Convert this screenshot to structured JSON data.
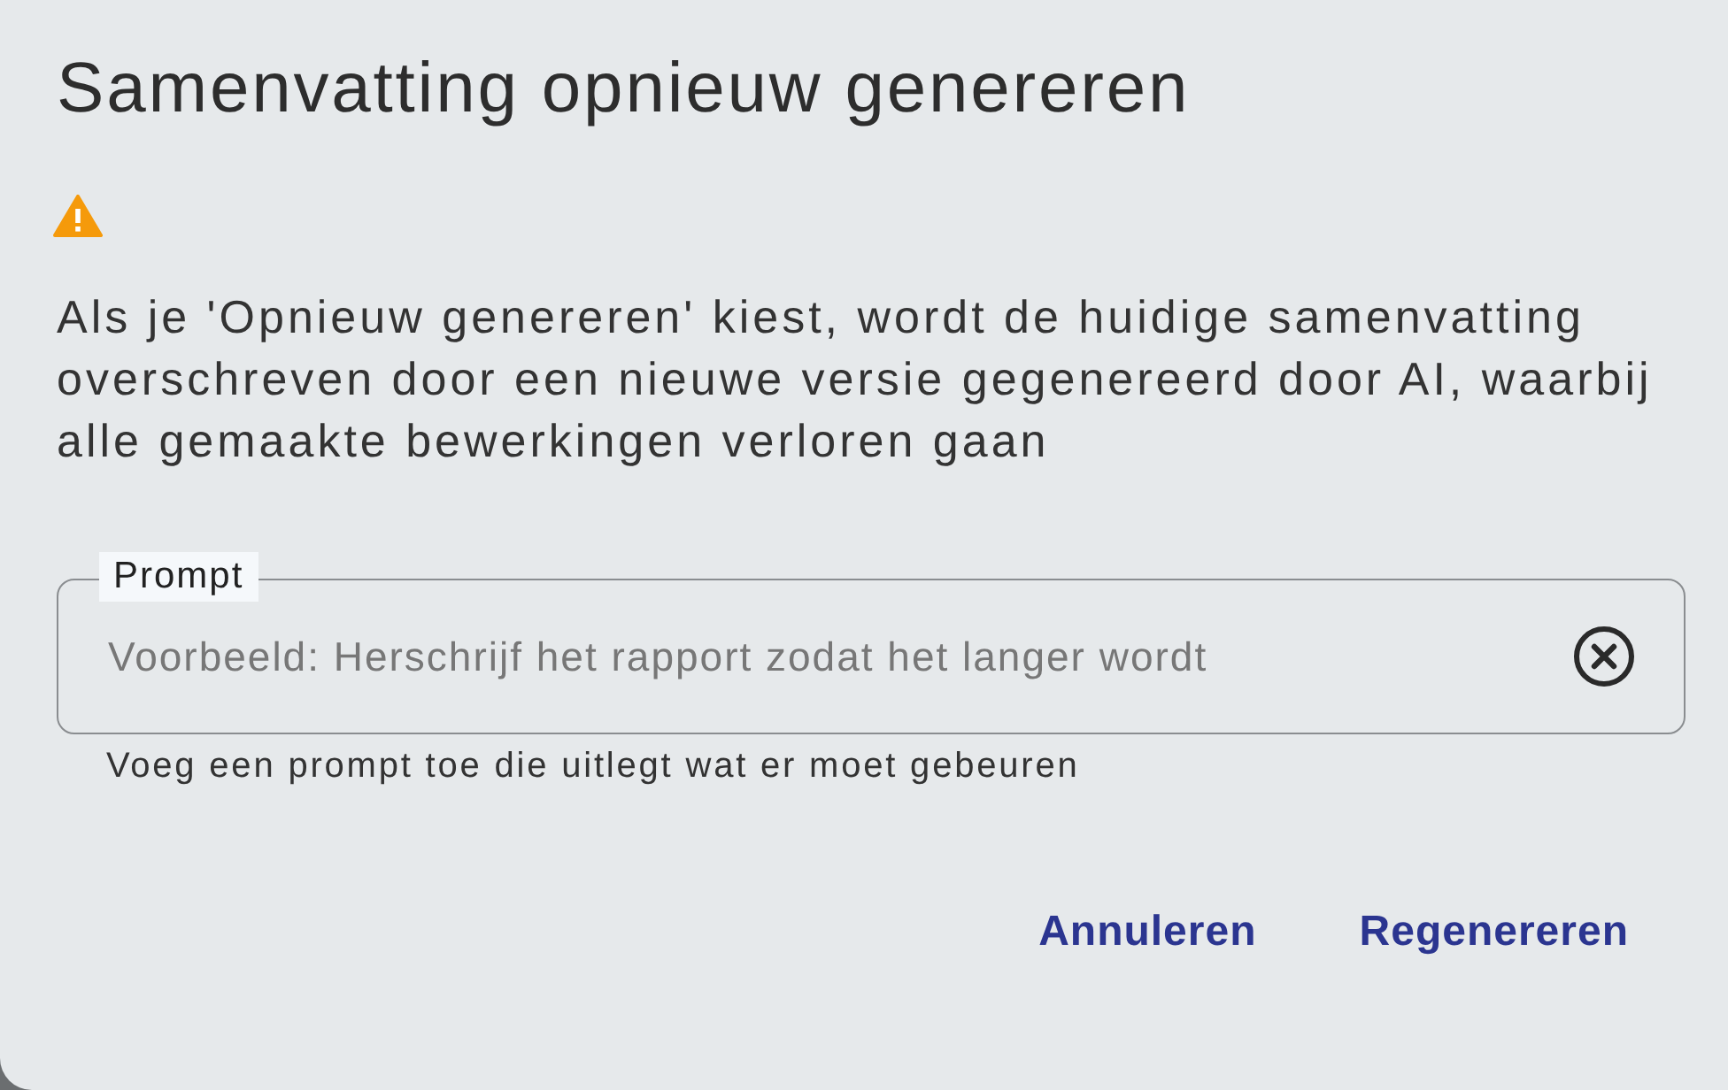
{
  "dialog": {
    "title": "Samenvatting opnieuw genereren",
    "warning": "Als je 'Opnieuw genereren' kiest, wordt de huidige samenvatting overschreven door een nieuwe versie gegenereerd door AI, waarbij alle gemaakte bewerkingen verloren gaan",
    "field": {
      "label": "Prompt",
      "placeholder": "Voorbeeld: Herschrijf het rapport zodat het langer wordt",
      "helper": "Voeg een prompt toe die uitlegt wat er moet gebeuren"
    },
    "buttons": [
      "Annuleren",
      "Regenereren"
    ]
  }
}
